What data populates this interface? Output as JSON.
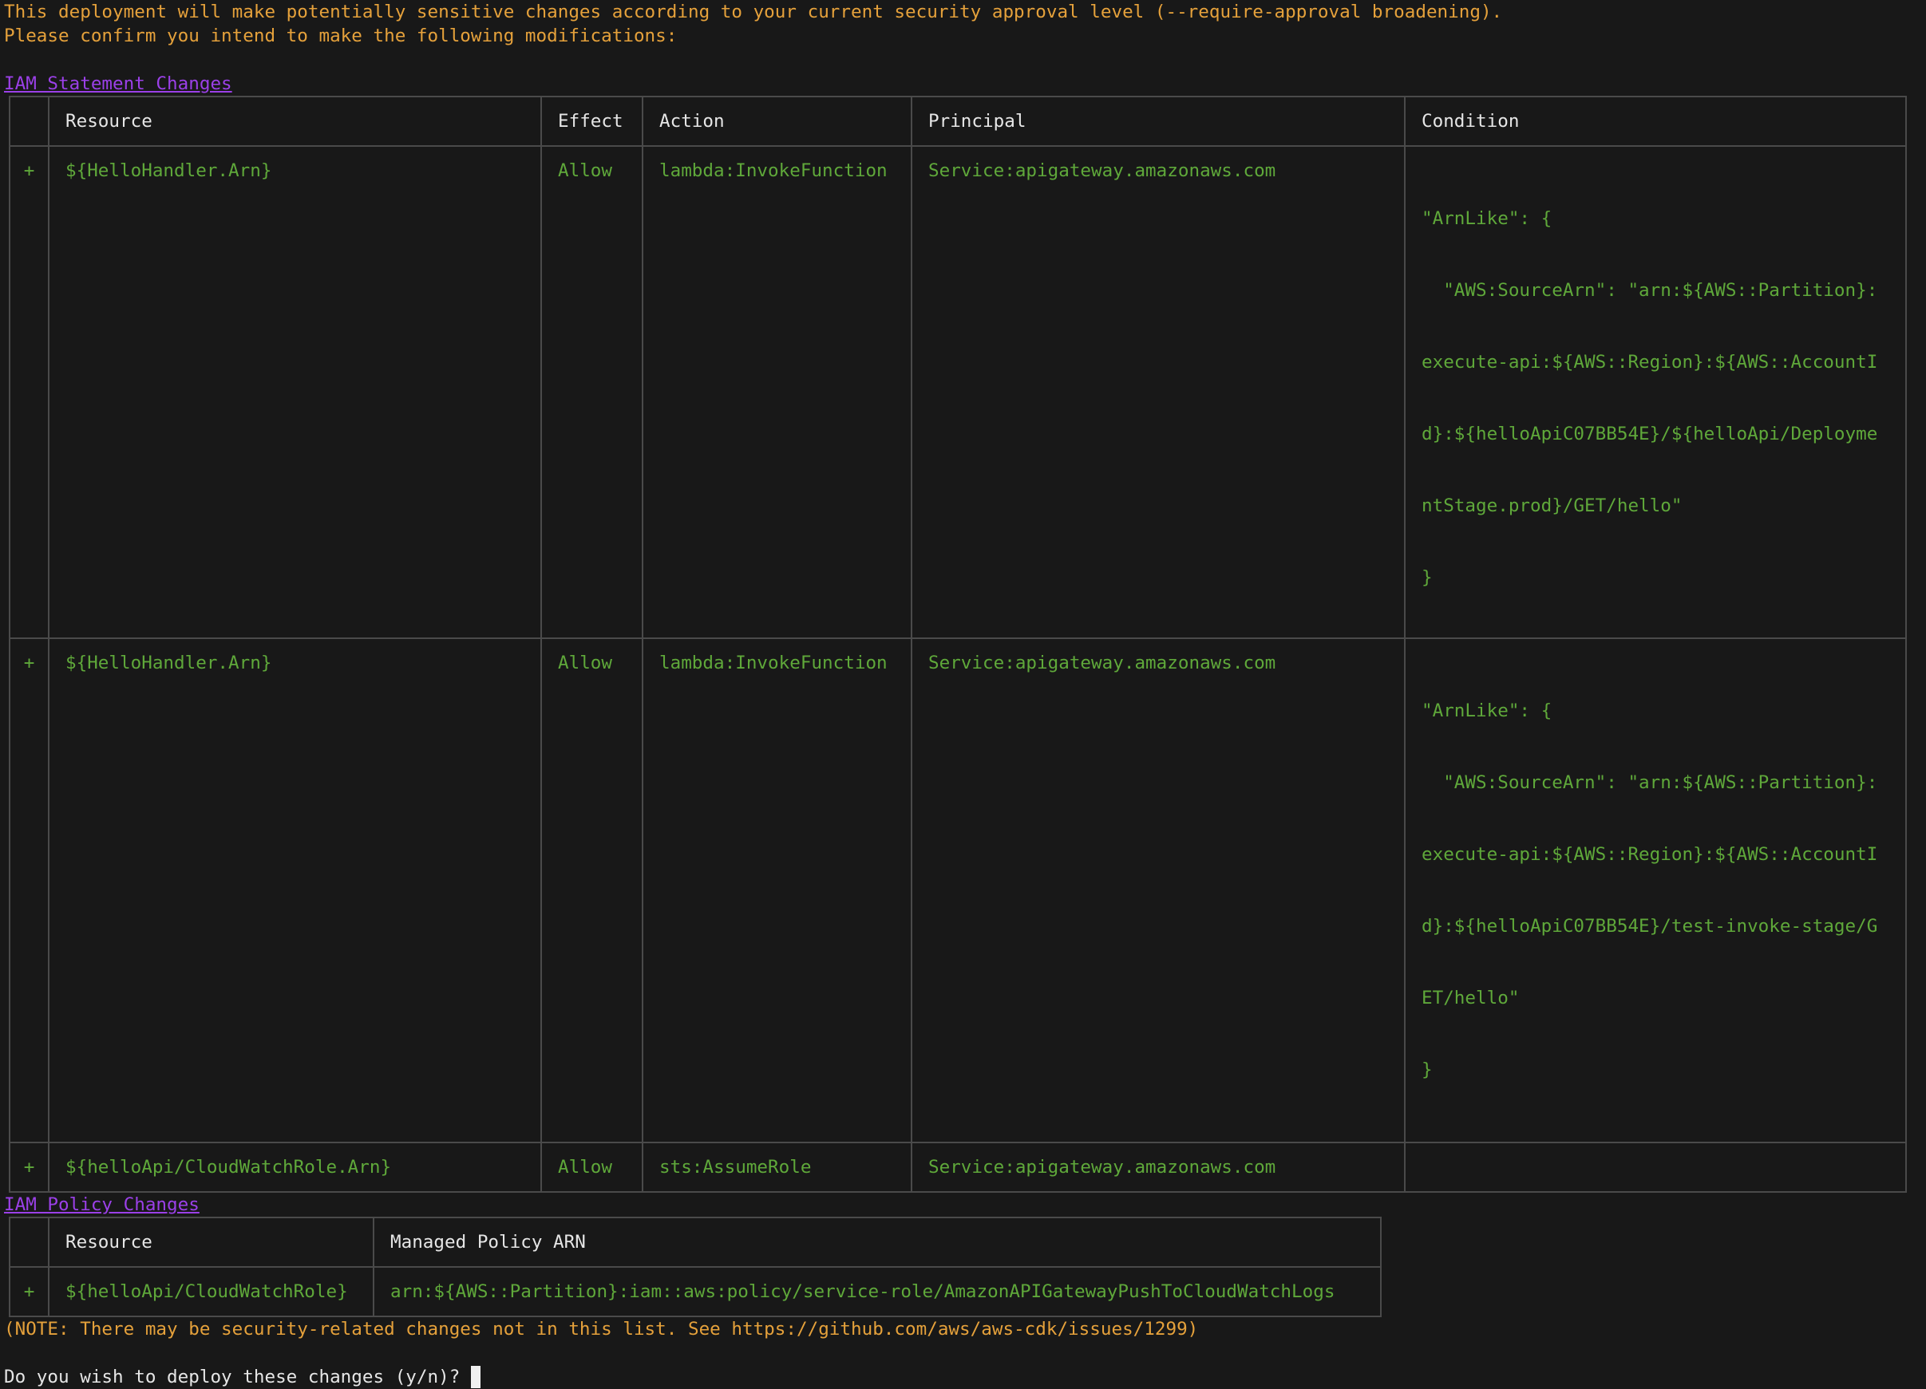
{
  "intro": {
    "line1": "This deployment will make potentially sensitive changes according to your current security approval level (--require-approval broadening).",
    "line2": "Please confirm you intend to make the following modifications:"
  },
  "statement_section": {
    "heading": "IAM Statement Changes",
    "headers": [
      "",
      "Resource",
      "Effect",
      "Action",
      "Principal",
      "Condition"
    ],
    "rows": [
      {
        "sign": "+",
        "resource": "${HelloHandler.Arn}",
        "effect": "Allow",
        "action": "lambda:InvokeFunction",
        "principal": "Service:apigateway.amazonaws.com",
        "condition": [
          "\"ArnLike\": {",
          "  \"AWS:SourceArn\": \"arn:${AWS::Partition}:",
          "execute-api:${AWS::Region}:${AWS::AccountI",
          "d}:${helloApiC07BB54E}/${helloApi/Deployme",
          "ntStage.prod}/GET/hello\"",
          "}"
        ]
      },
      {
        "sign": "+",
        "resource": "${HelloHandler.Arn}",
        "effect": "Allow",
        "action": "lambda:InvokeFunction",
        "principal": "Service:apigateway.amazonaws.com",
        "condition": [
          "\"ArnLike\": {",
          "  \"AWS:SourceArn\": \"arn:${AWS::Partition}:",
          "execute-api:${AWS::Region}:${AWS::AccountI",
          "d}:${helloApiC07BB54E}/test-invoke-stage/G",
          "ET/hello\"",
          "}"
        ]
      },
      {
        "sign": "+",
        "resource": "${helloApi/CloudWatchRole.Arn}",
        "effect": "Allow",
        "action": "sts:AssumeRole",
        "principal": "Service:apigateway.amazonaws.com",
        "condition": []
      }
    ]
  },
  "policy_section": {
    "heading": "IAM Policy Changes",
    "headers": [
      "",
      "Resource",
      "Managed Policy ARN"
    ],
    "rows": [
      {
        "sign": "+",
        "resource": "${helloApi/CloudWatchRole}",
        "arn": "arn:${AWS::Partition}:iam::aws:policy/service-role/AmazonAPIGatewayPushToCloudWatchLogs"
      }
    ]
  },
  "note": "(NOTE: There may be security-related changes not in this list. See https://github.com/aws/aws-cdk/issues/1299)",
  "prompt": "Do you wish to deploy these changes (y/n)? ",
  "colors": {
    "background": "#181818",
    "orange": "#e5a13b",
    "green": "#5fa83a",
    "purple": "#9b40e8",
    "white": "#e6e6e6"
  }
}
